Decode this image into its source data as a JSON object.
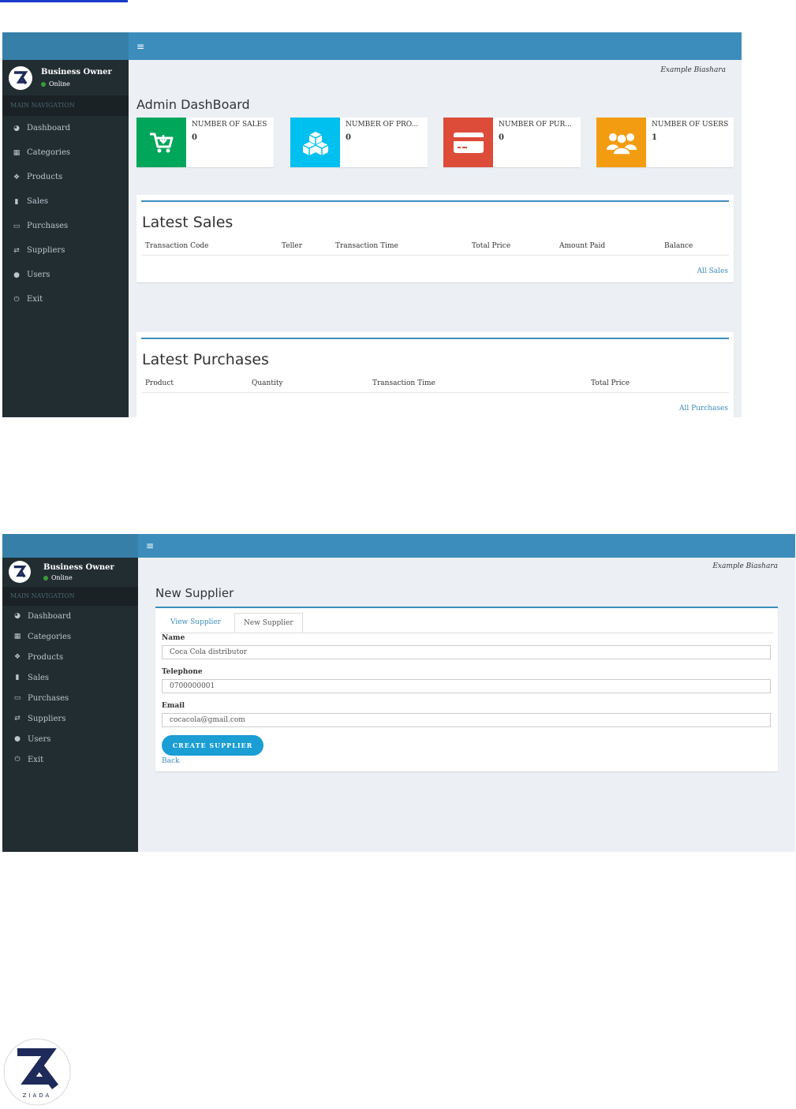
{
  "screen1": {
    "sidebar": {
      "user_name": "Business Owner",
      "status": "Online",
      "nav_header": "MAIN NAVIGATION",
      "items": [
        {
          "label": "Dashboard",
          "icon": "dashboard-icon"
        },
        {
          "label": "Categories",
          "icon": "grid-icon"
        },
        {
          "label": "Products",
          "icon": "cubes-icon"
        },
        {
          "label": "Sales",
          "icon": "database-icon"
        },
        {
          "label": "Purchases",
          "icon": "credit-card-icon"
        },
        {
          "label": "Suppliers",
          "icon": "exchange-icon"
        },
        {
          "label": "Users",
          "icon": "user-icon"
        },
        {
          "label": "Exit",
          "icon": "power-icon"
        }
      ]
    },
    "site_name": "Example Biashara",
    "page_title": "Admin DashBoard",
    "info_boxes": [
      {
        "label": "NUMBER OF SALES",
        "value": "0",
        "color": "#00a65a",
        "icon": "cart-icon"
      },
      {
        "label": "NUMBER OF PRO...",
        "value": "0",
        "color": "#00c0ef",
        "icon": "cubes-icon"
      },
      {
        "label": "NUMBER OF PUR...",
        "value": "0",
        "color": "#dd4b39",
        "icon": "credit-card-icon"
      },
      {
        "label": "NUMBER OF USERS",
        "value": "1",
        "color": "#f39c12",
        "icon": "users-icon"
      }
    ],
    "latest_sales": {
      "title": "Latest Sales",
      "columns": [
        "Transaction Code",
        "Teller",
        "Transaction Time",
        "Total Price",
        "Amount Paid",
        "Balance"
      ],
      "link": "All Sales"
    },
    "latest_purchases": {
      "title": "Latest Purchases",
      "columns": [
        "Product",
        "Quantity",
        "Transaction Time",
        "Total Price"
      ],
      "link": "All Purchases"
    }
  },
  "screen2": {
    "sidebar": {
      "user_name": "Business Owner",
      "status": "Online",
      "nav_header": "MAIN NAVIGATION",
      "items": [
        {
          "label": "Dashboard"
        },
        {
          "label": "Categories"
        },
        {
          "label": "Products"
        },
        {
          "label": "Sales"
        },
        {
          "label": "Purchases"
        },
        {
          "label": "Suppliers"
        },
        {
          "label": "Users"
        },
        {
          "label": "Exit"
        }
      ]
    },
    "site_name": "Example Biashara",
    "page_title": "New Supplier",
    "tabs": [
      "View Supplier",
      "New Supplier"
    ],
    "form": {
      "name_label": "Name",
      "name_value": "Coca Cola distributor",
      "telephone_label": "Telephone",
      "telephone_value": "0700000001",
      "email_label": "Email",
      "email_value": "cocacola@gmail.com",
      "submit_label": "CREATE SUPPLIER",
      "back_label": "Back"
    }
  },
  "footer_logo": {
    "text": "ZIADA"
  }
}
